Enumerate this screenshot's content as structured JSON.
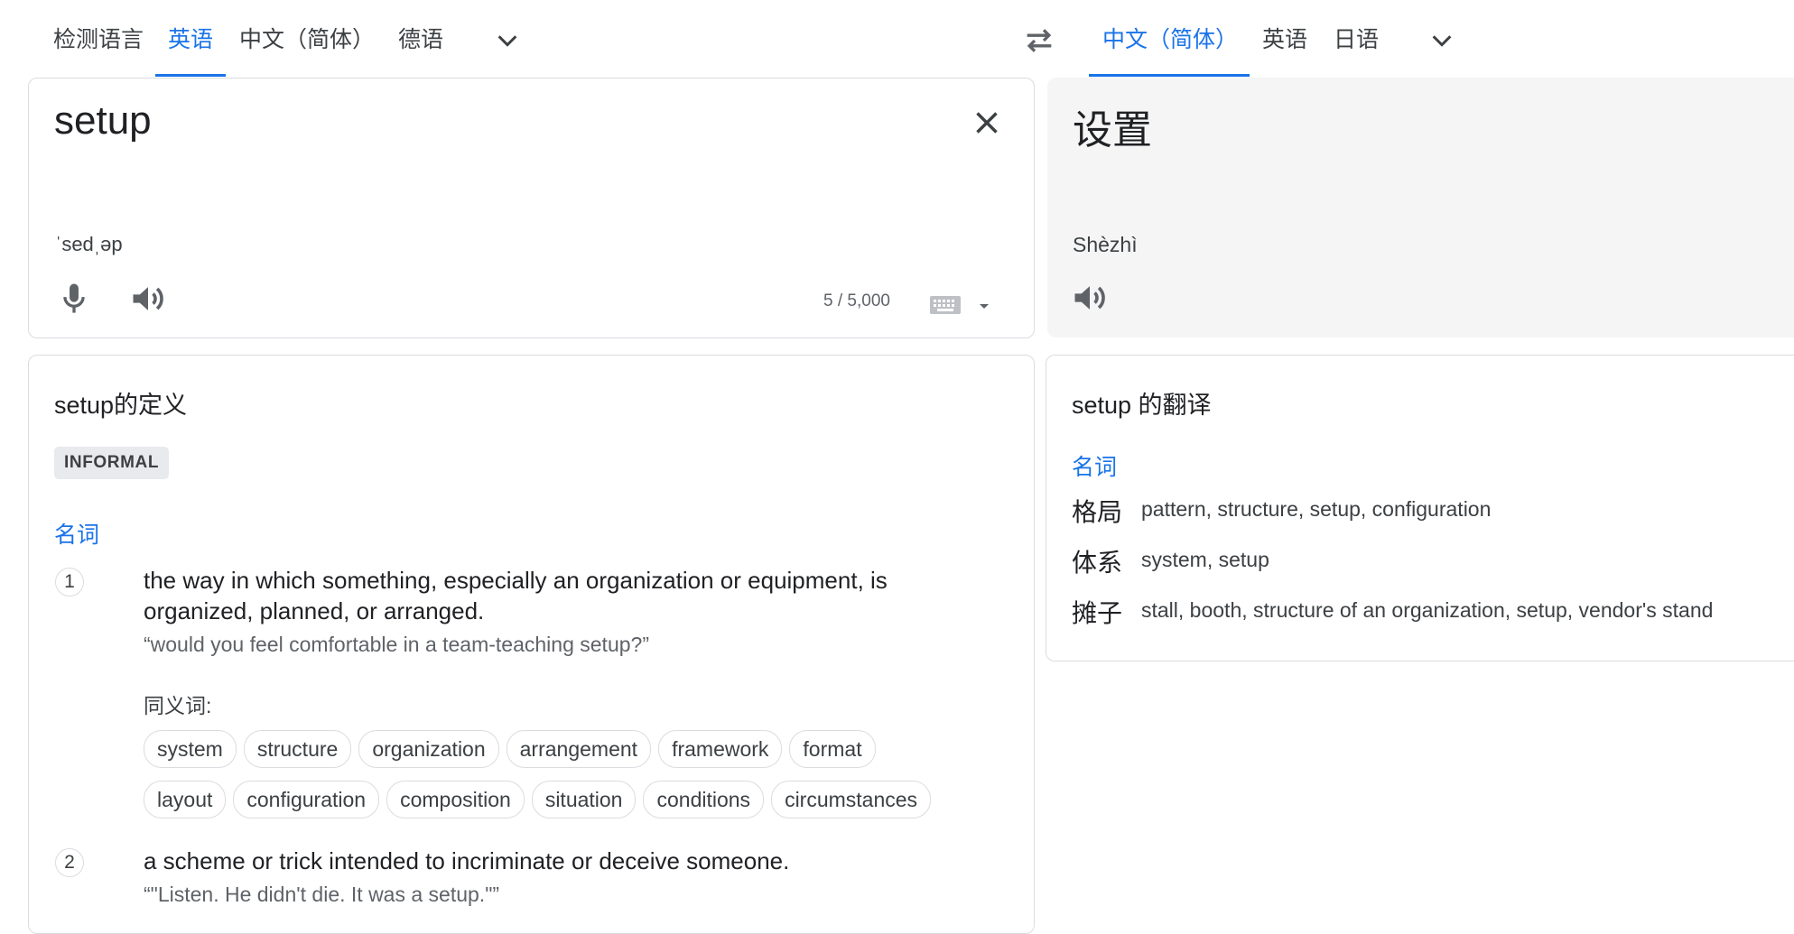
{
  "source_langs": {
    "tabs": [
      "检测语言",
      "英语",
      "中文（简体）",
      "德语"
    ],
    "active_index": 1
  },
  "target_langs": {
    "tabs": [
      "中文（简体）",
      "英语",
      "日语"
    ],
    "active_index": 0
  },
  "source": {
    "text": "setup",
    "phonetic": "ˈsedˌəp",
    "char_count": "5 / 5,000"
  },
  "target": {
    "text": "设置",
    "romanization": "Shèzhì"
  },
  "definitions": {
    "title": "setup的定义",
    "register_badge": "INFORMAL",
    "part_of_speech": "名词",
    "entries": [
      {
        "number": "1",
        "gloss_line1": "the way in which something, especially an organization or equipment, is",
        "gloss_line2": "organized, planned, or arranged.",
        "example": "“would you feel comfortable in a team-teaching setup?”",
        "synonyms_label": "同义词:",
        "synonyms_row1": [
          "system",
          "structure",
          "organization",
          "arrangement",
          "framework",
          "format"
        ],
        "synonyms_row2": [
          "layout",
          "configuration",
          "composition",
          "situation",
          "conditions",
          "circumstances"
        ]
      },
      {
        "number": "2",
        "gloss_line1": "a scheme or trick intended to incriminate or deceive someone.",
        "example": "“\"Listen. He didn't die. It was a setup.\"”"
      }
    ]
  },
  "translations": {
    "title": "setup 的翻译",
    "part_of_speech": "名词",
    "rows": [
      {
        "word": "格局",
        "back": "pattern, structure, setup, configuration"
      },
      {
        "word": "体系",
        "back": "system, setup"
      },
      {
        "word": "摊子",
        "back": "stall, booth, structure of an organization, setup, vendor's stand"
      }
    ]
  },
  "icons": {
    "swap": "swap-languages-icon",
    "clear": "close-icon",
    "mic": "microphone-icon",
    "speaker": "speaker-icon",
    "keyboard": "keyboard-icon",
    "dropdown": "chevron-down-icon"
  },
  "colors": {
    "accent": "#1a73e8",
    "border": "#dadce0",
    "target_bg": "#f5f5f5",
    "badge_bg": "#e8eaed"
  }
}
